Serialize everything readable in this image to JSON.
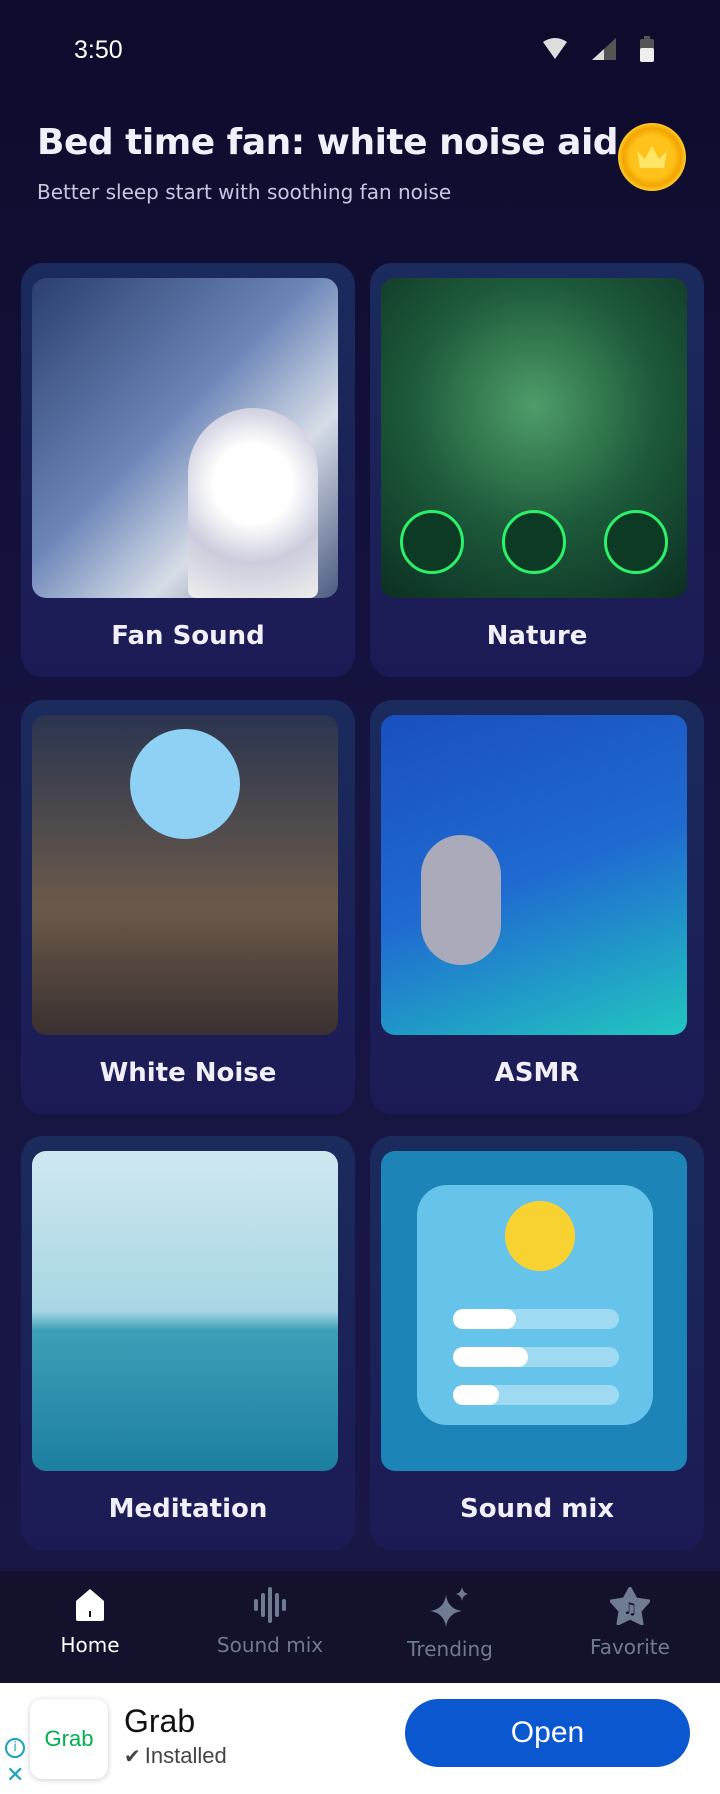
{
  "status": {
    "time": "3:50"
  },
  "header": {
    "title": "Bed time fan: white noise aid",
    "subtitle": "Better sleep start with soothing fan noise",
    "premium_icon": "crown-coin-icon"
  },
  "cards": [
    {
      "label": "Fan Sound"
    },
    {
      "label": "Nature"
    },
    {
      "label": "White Noise"
    },
    {
      "label": "ASMR"
    },
    {
      "label": "Meditation"
    },
    {
      "label": "Sound mix"
    }
  ],
  "nav": {
    "items": [
      {
        "label": "Home",
        "icon": "home-icon",
        "active": true
      },
      {
        "label": "Sound mix",
        "icon": "waveform-icon"
      },
      {
        "label": "Trending",
        "icon": "sparkle-icon"
      },
      {
        "label": "Favorite",
        "icon": "star-music-icon"
      }
    ]
  },
  "ad": {
    "logo_text": "Grab",
    "app_name": "Grab",
    "status": "Installed",
    "button": "Open",
    "accent": "#0b57d0",
    "logo_color": "#00b14f"
  }
}
